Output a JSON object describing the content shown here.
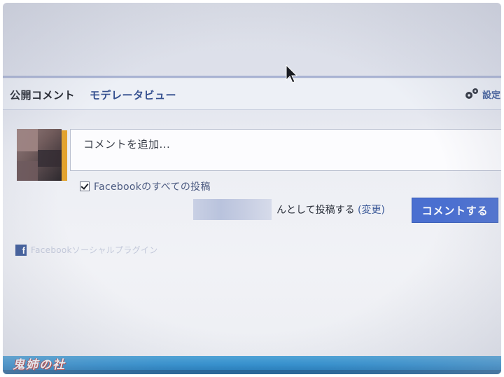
{
  "tabs": {
    "public": "公開コメント",
    "moderator": "モデレータビュー"
  },
  "settings": {
    "label": "設定"
  },
  "comment": {
    "placeholder": "コメントを追加..."
  },
  "facebook_post": {
    "label": "Facebookのすべての投稿",
    "checked": true
  },
  "post_as": {
    "text": "んとして投稿する",
    "change": "(変更)"
  },
  "submit": {
    "label": "コメントする"
  },
  "plugin": {
    "label": "Facebookソーシャルプラグイン"
  },
  "watermark": {
    "text": "鬼姉の社"
  },
  "colors": {
    "accent": "#4a6fd0",
    "link": "#3b5998",
    "bottom_bar": "#2c8ecf"
  }
}
